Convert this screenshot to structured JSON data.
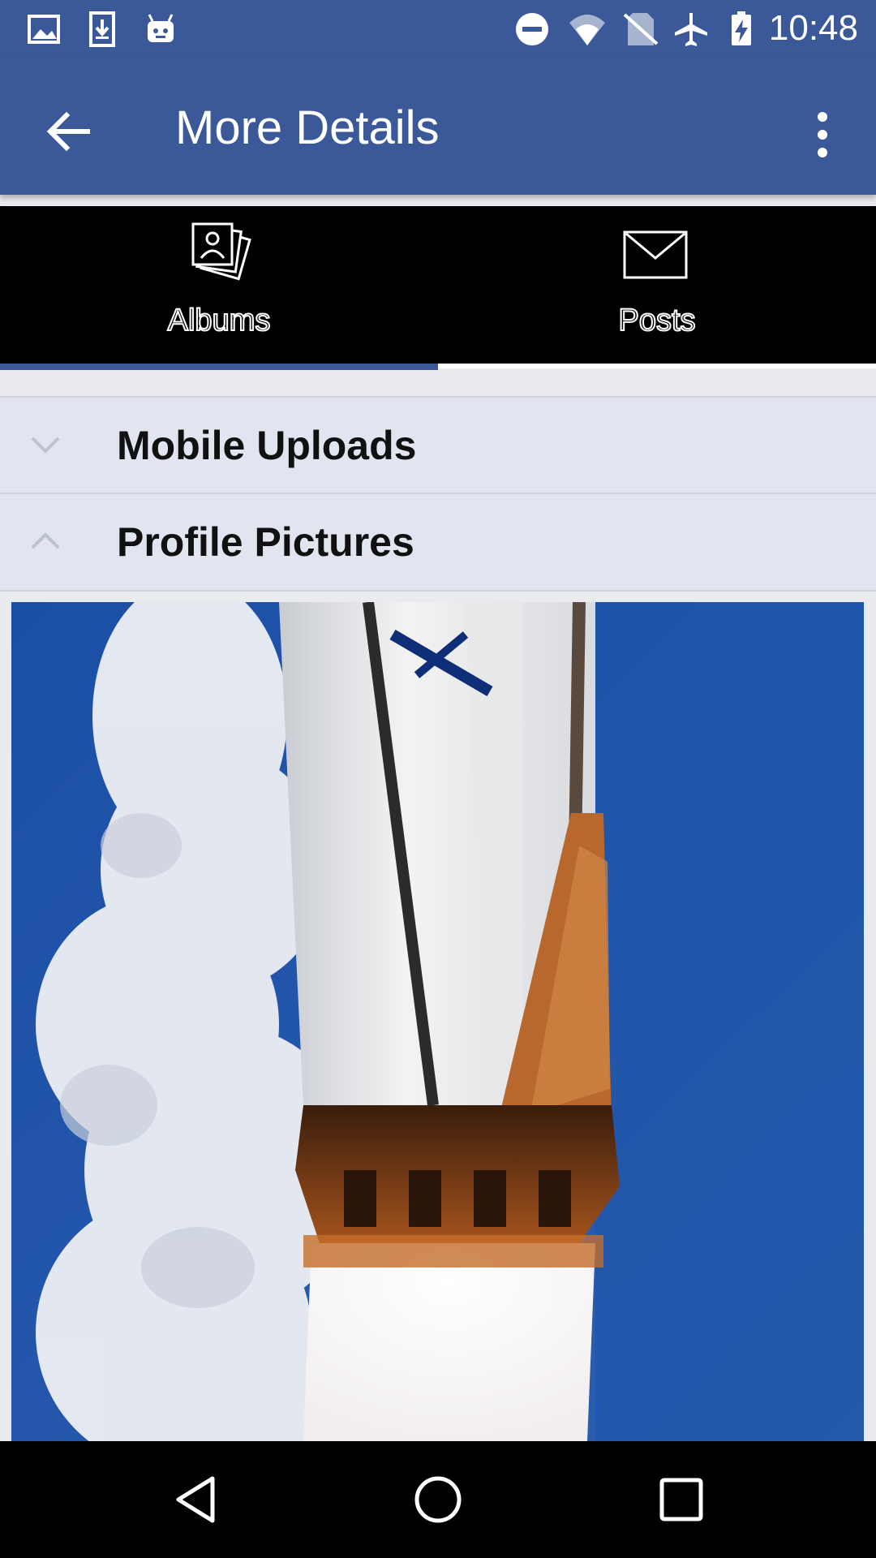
{
  "status_bar": {
    "time": "10:48",
    "left_icons": [
      "image-icon",
      "download-icon",
      "android-icon"
    ],
    "right_icons": [
      "do-not-disturb-icon",
      "wifi-icon",
      "no-sim-icon",
      "airplane-mode-icon",
      "battery-charging-icon"
    ]
  },
  "app_bar": {
    "title": "More Details",
    "back_icon": "arrow-back-icon",
    "menu_icon": "more-vert-icon"
  },
  "tabs": [
    {
      "label": "Albums",
      "icon": "photo-album-icon",
      "selected": true
    },
    {
      "label": "Posts",
      "icon": "mail-icon",
      "selected": false
    }
  ],
  "albums": [
    {
      "label": "Mobile Uploads",
      "expanded": false,
      "icon": "chevron-down-icon"
    },
    {
      "label": "Profile Pictures",
      "expanded": true,
      "icon": "chevron-up-icon"
    }
  ],
  "colors": {
    "brand": "#3b5998",
    "tab_bar": "#000000",
    "list_background": "#e1e5ef"
  },
  "nav_bar": {
    "icons": [
      "nav-back-icon",
      "nav-home-icon",
      "nav-recents-icon"
    ]
  }
}
